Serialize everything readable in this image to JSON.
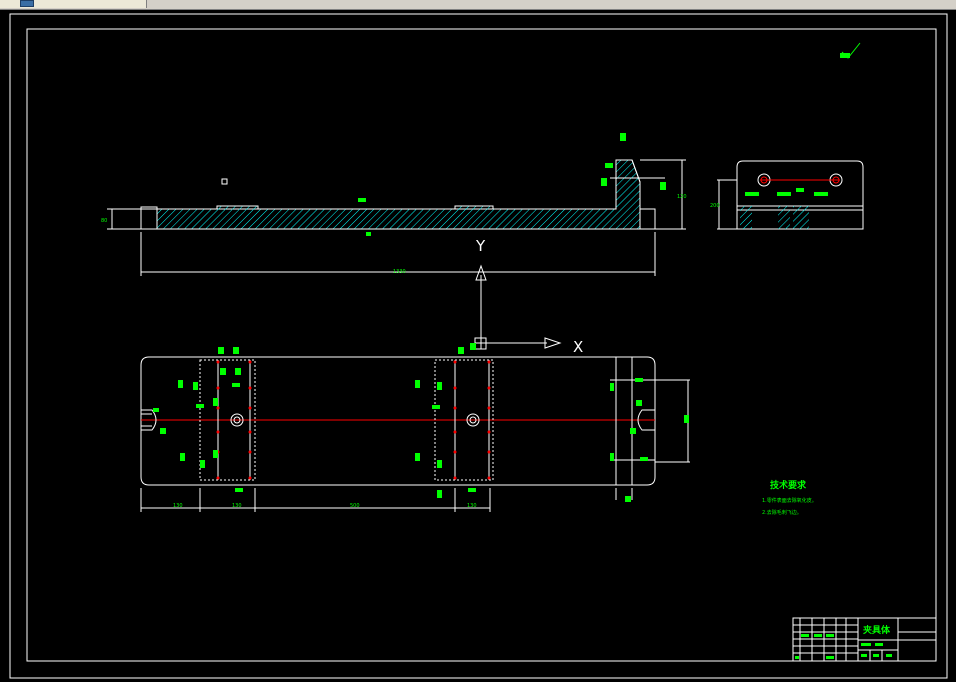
{
  "window": {
    "tab_icon": "document-icon"
  },
  "drawing": {
    "colors": {
      "background": "#000000",
      "outline": "#ffffff",
      "dimension": "#00ff00",
      "hatch": "#00ffff",
      "centerline": "#ff0000"
    },
    "axis_labels": {
      "x": "X",
      "y": "Y"
    },
    "dimensions": {
      "overall_length": "1330",
      "left_offset": "130",
      "pitch_1": "130",
      "pitch_2": "500",
      "pitch_3": "130",
      "side_height": "200",
      "front_height": "120",
      "base_height": "80"
    },
    "technical_requirements": {
      "title": "技术要求",
      "items": [
        "1.零件表面去除氧化皮。",
        "2.去除毛刺飞边。"
      ]
    },
    "title_block": {
      "name": "夹具体"
    }
  }
}
